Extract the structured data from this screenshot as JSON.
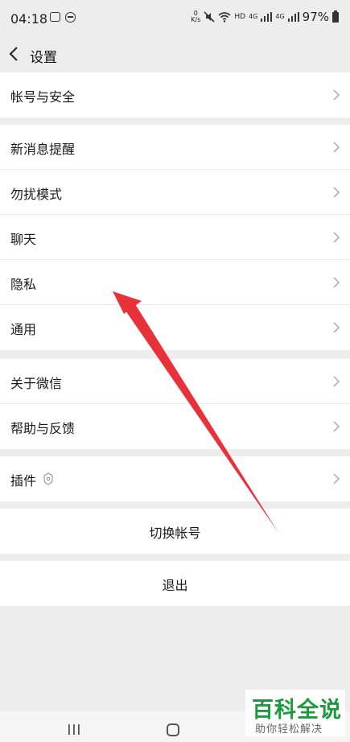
{
  "status_bar": {
    "time": "04:18",
    "net_speed_top": "0",
    "net_speed_unit": "K/s",
    "hd_label": "HD",
    "lte_label_1": "4G",
    "lte_label_2": "4G",
    "battery": "97%"
  },
  "header": {
    "title": "设置"
  },
  "groups": {
    "account": {
      "label": "帐号与安全"
    },
    "notifications": {
      "label": "新消息提醒"
    },
    "dnd": {
      "label": "勿扰模式"
    },
    "chat": {
      "label": "聊天"
    },
    "privacy": {
      "label": "隐私"
    },
    "general": {
      "label": "通用"
    },
    "about": {
      "label": "关于微信"
    },
    "help": {
      "label": "帮助与反馈"
    },
    "plugins": {
      "label": "插件"
    }
  },
  "actions": {
    "switch_account": "切换帐号",
    "logout": "退出"
  },
  "watermark": {
    "main": "百科全说",
    "sub": "助你轻松解决"
  },
  "colors": {
    "background": "#ededed",
    "row": "#ffffff",
    "annotation_arrow": "#e8323a",
    "watermark_green": "#1d9a3f"
  }
}
